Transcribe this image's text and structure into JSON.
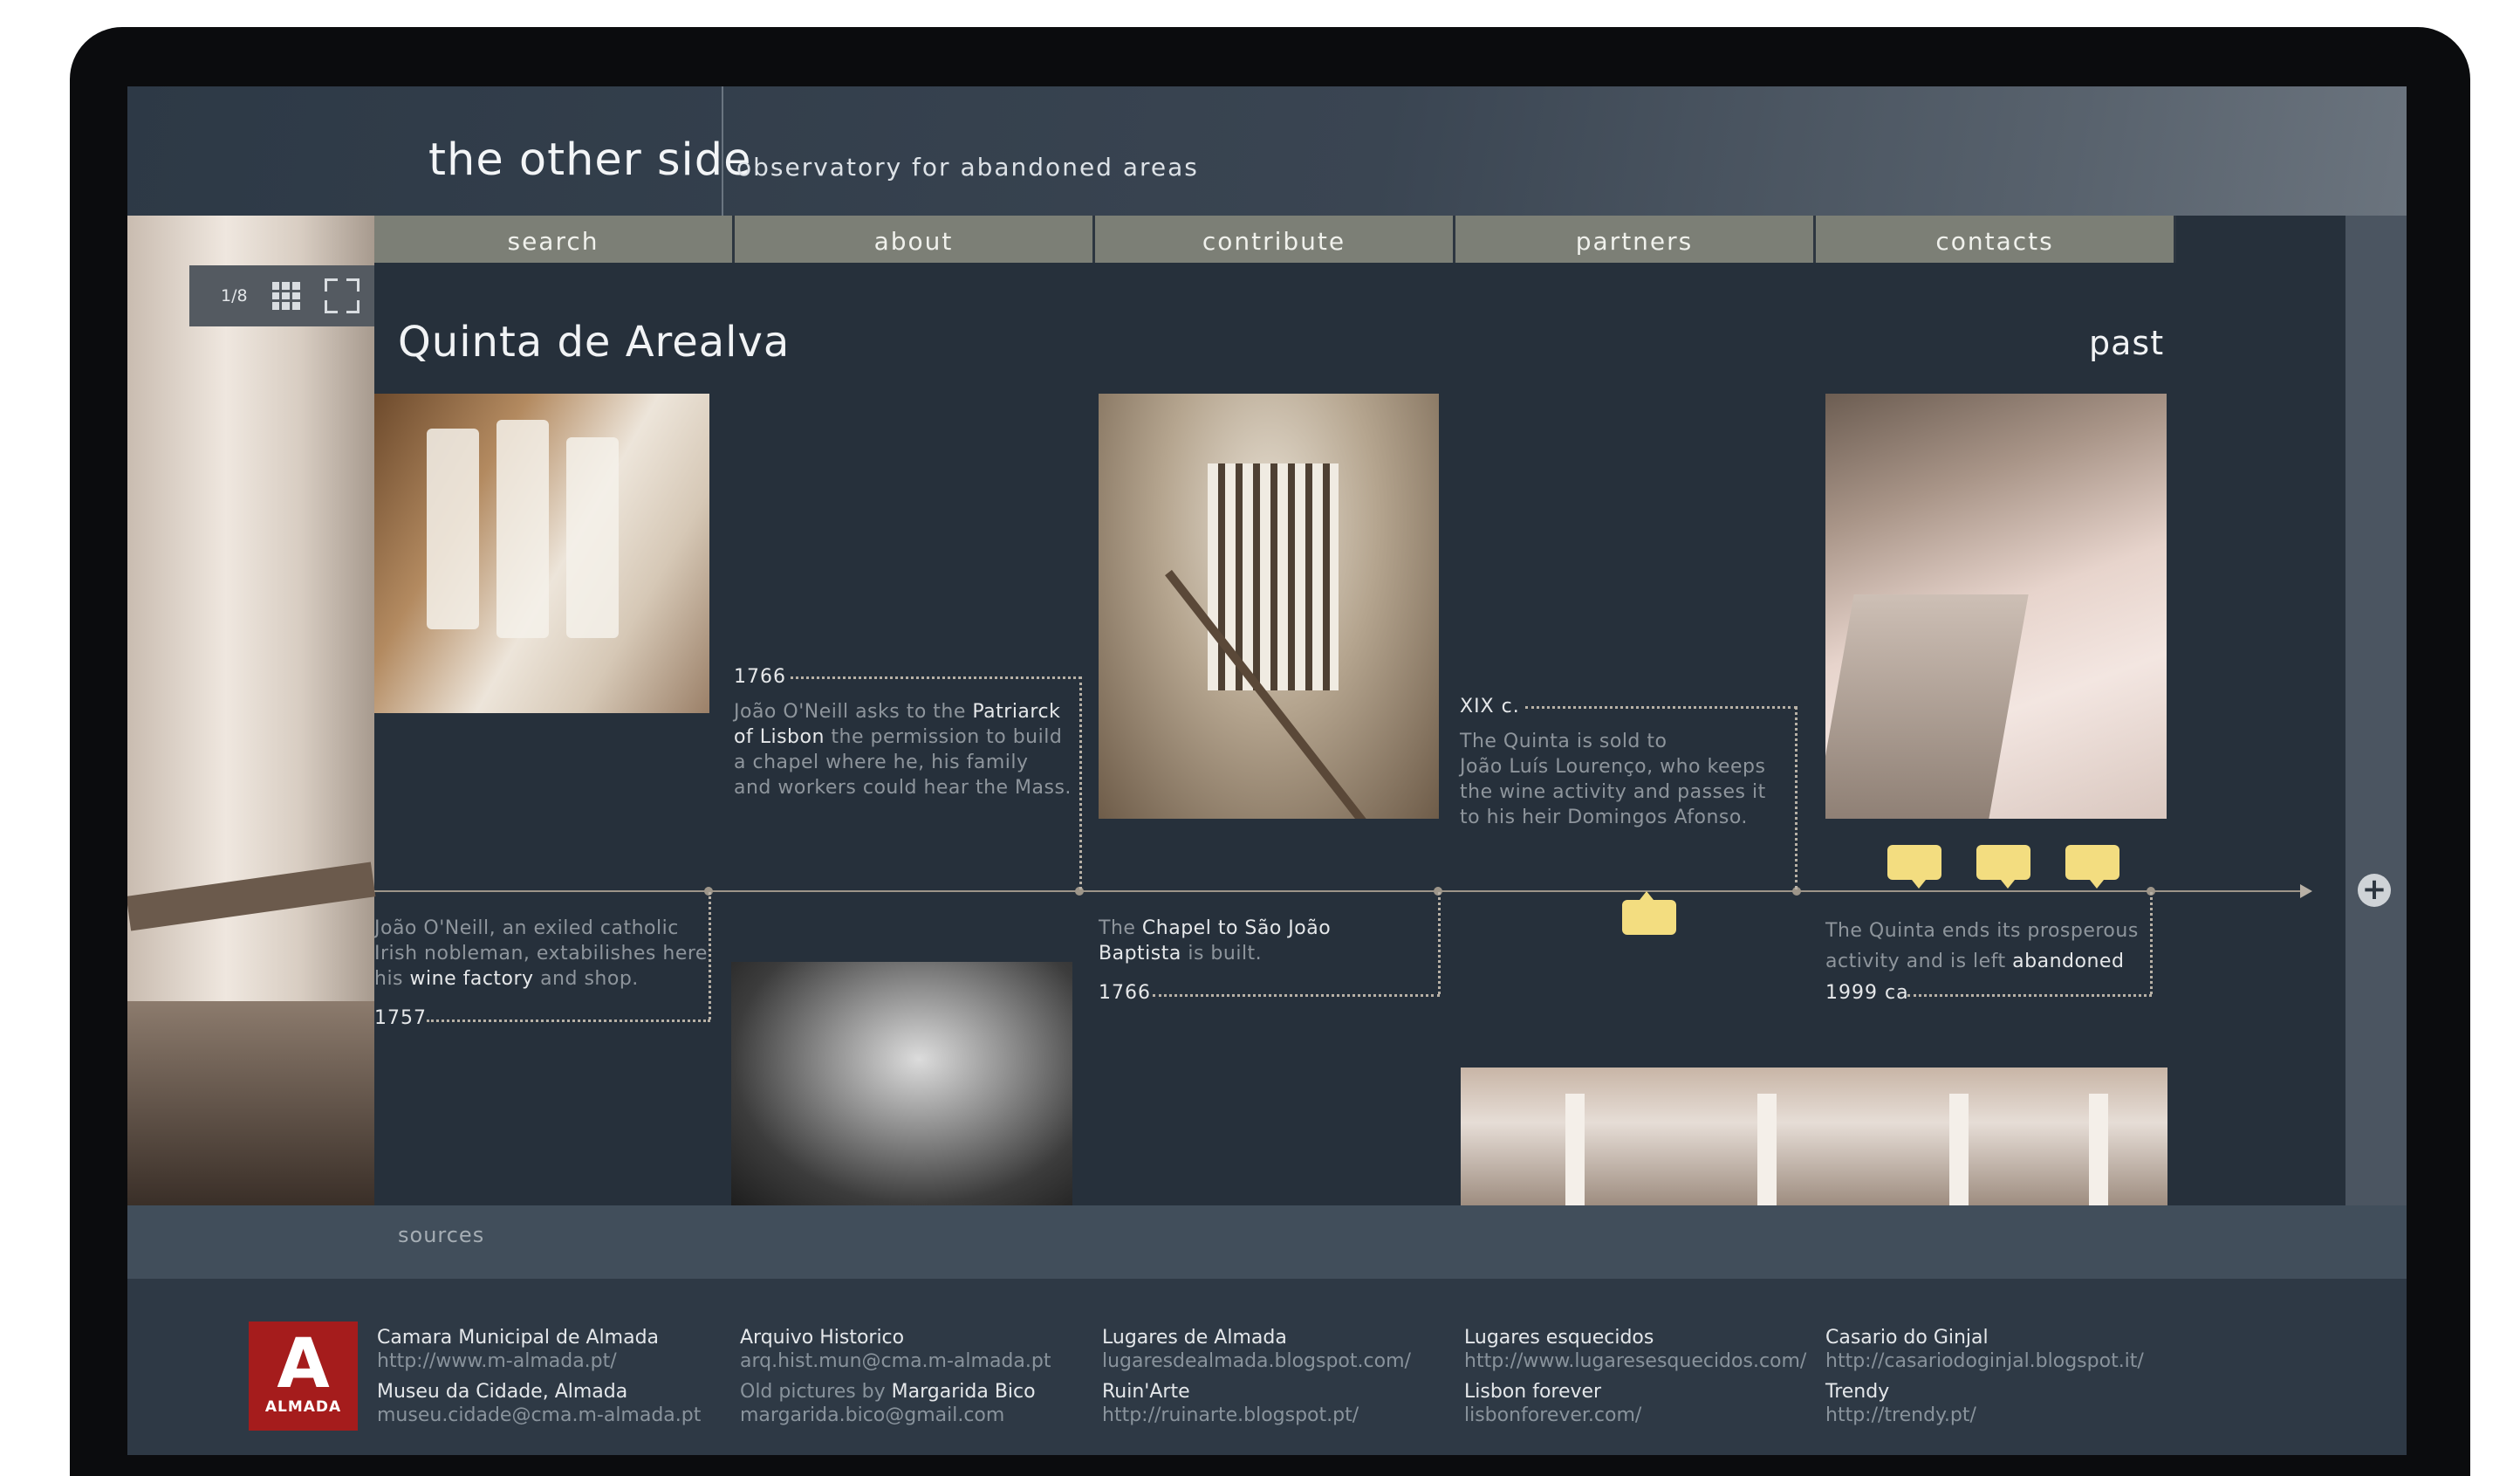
{
  "header": {
    "title": "the other side",
    "subtitle": "observatory for abandoned areas"
  },
  "nav": [
    "search",
    "about",
    "contribute",
    "partners",
    "contacts"
  ],
  "viewer": {
    "counter": "1/8"
  },
  "place": {
    "title": "Quinta de Arealva",
    "period": "past"
  },
  "events": {
    "e1766a": {
      "date": "1766",
      "pre": "João O'Neill asks to the ",
      "hl1": "Patriarck",
      "hl2": "of Lisbon",
      "post1": " the permission to build",
      "l3": "a chapel where he, his family",
      "l4": "and workers could hear the Mass."
    },
    "e19c": {
      "date": "XIX c.",
      "l1": "The Quinta is sold to",
      "l2": "João Luís Lourenço, who keeps",
      "l3": "the wine activity and passes it",
      "l4": "to his heir Domingos Afonso."
    },
    "e1757": {
      "date": "1757",
      "l1": "João O'Neill, an exiled catholic",
      "l2": "Irish nobleman, extabilishes here",
      "l3a": "his ",
      "l3b": "wine factory",
      "l3c": " and shop."
    },
    "e1766b": {
      "date": "1766",
      "l1a": "The ",
      "l1b": "Chapel to São João",
      "l2a": "Baptista",
      "l2b": " is built."
    },
    "e1999": {
      "date": "1999 ca",
      "l1": "The Quinta ends its prosperous",
      "l2a": "activity and is left ",
      "l2b": "abandoned"
    }
  },
  "sources": {
    "label": "sources",
    "logo": {
      "letter": "A",
      "word": "ALMADA"
    },
    "items": [
      {
        "name": "Camara Municipal de Almada",
        "url": "http://www.m-almada.pt/",
        "name2": "Museu da Cidade, Almada",
        "url2": "museu.cidade@cma.m-almada.pt"
      },
      {
        "name": "Arquivo Historico",
        "url": "arq.hist.mun@cma.m-almada.pt",
        "name2pre": "Old pictures by ",
        "name2": "Margarida Bico",
        "url2": "margarida.bico@gmail.com"
      },
      {
        "name": "Lugares de Almada",
        "url": "lugaresdealmada.blogspot.com/",
        "name2": "Ruin'Arte",
        "url2": "http://ruinarte.blogspot.pt/"
      },
      {
        "name": "Lugares esquecidos",
        "url": "http://www.lugaresesquecidos.com/",
        "name2": "Lisbon forever",
        "url2": "lisbonforever.com/"
      },
      {
        "name": "Casario do Ginjal",
        "url": "http://casariodoginjal.blogspot.it/",
        "name2": "Trendy",
        "url2": "http://trendy.pt/"
      }
    ]
  },
  "colors": {
    "accent_comment": "#f3dd80",
    "nav_bg": "#7c7f76",
    "logo_red": "#a51c1c",
    "screen_bg": "#26303b"
  },
  "icons": [
    "grid-icon",
    "fullscreen-icon",
    "plus-icon",
    "comment-icon"
  ]
}
